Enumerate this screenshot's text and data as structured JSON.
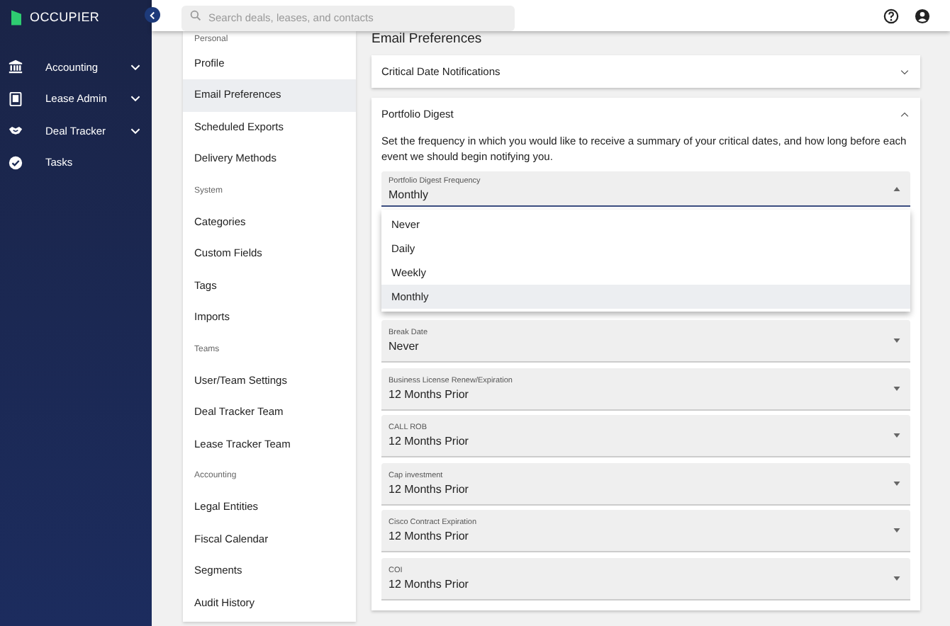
{
  "brand": "OCCUPIER",
  "sidebar": {
    "items": [
      {
        "label": "Accounting",
        "expandable": true
      },
      {
        "label": "Lease Admin",
        "expandable": true
      },
      {
        "label": "Deal Tracker",
        "expandable": true
      },
      {
        "label": "Tasks",
        "expandable": false
      }
    ]
  },
  "search": {
    "placeholder": "Search deals, leases, and contacts"
  },
  "settings_nav": [
    {
      "kind": "heading",
      "label": "Personal"
    },
    {
      "kind": "item",
      "label": "Profile",
      "selected": false
    },
    {
      "kind": "item",
      "label": "Email Preferences",
      "selected": true
    },
    {
      "kind": "item",
      "label": "Scheduled Exports",
      "selected": false
    },
    {
      "kind": "item",
      "label": "Delivery Methods",
      "selected": false
    },
    {
      "kind": "heading",
      "label": "System"
    },
    {
      "kind": "item",
      "label": "Categories",
      "selected": false
    },
    {
      "kind": "item",
      "label": "Custom Fields",
      "selected": false
    },
    {
      "kind": "item",
      "label": "Tags",
      "selected": false
    },
    {
      "kind": "item",
      "label": "Imports",
      "selected": false
    },
    {
      "kind": "heading",
      "label": "Teams"
    },
    {
      "kind": "item",
      "label": "User/Team Settings",
      "selected": false
    },
    {
      "kind": "item",
      "label": "Deal Tracker Team",
      "selected": false
    },
    {
      "kind": "item",
      "label": "Lease Tracker Team",
      "selected": false
    },
    {
      "kind": "heading",
      "label": "Accounting"
    },
    {
      "kind": "item",
      "label": "Legal Entities",
      "selected": false
    },
    {
      "kind": "item",
      "label": "Fiscal Calendar",
      "selected": false
    },
    {
      "kind": "item",
      "label": "Segments",
      "selected": false
    },
    {
      "kind": "item",
      "label": "Audit History",
      "selected": false
    }
  ],
  "page_title": "Email Preferences",
  "sections": [
    {
      "title": "Critical Date Notifications",
      "expanded": false
    },
    {
      "title": "Portfolio Digest",
      "expanded": true,
      "description": "Set the frequency in which you would like to receive a summary of your critical dates, and how long before each event we should begin notifying you.",
      "frequency": {
        "label": "Portfolio Digest Frequency",
        "value": "Monthly",
        "open": true,
        "options": [
          {
            "label": "Never",
            "selected": false
          },
          {
            "label": "Daily",
            "selected": false
          },
          {
            "label": "Weekly",
            "selected": false
          },
          {
            "label": "Monthly",
            "selected": true
          }
        ]
      },
      "fields": [
        {
          "label": "Break Date",
          "value": "Never"
        },
        {
          "label": "Business License Renew/Expiration",
          "value": "12 Months Prior"
        },
        {
          "label": "CALL ROB",
          "value": "12 Months Prior"
        },
        {
          "label": "Cap investment",
          "value": "12 Months Prior"
        },
        {
          "label": "Cisco Contract Expiration",
          "value": "12 Months Prior"
        },
        {
          "label": "COI",
          "value": "12 Months Prior"
        }
      ]
    }
  ]
}
